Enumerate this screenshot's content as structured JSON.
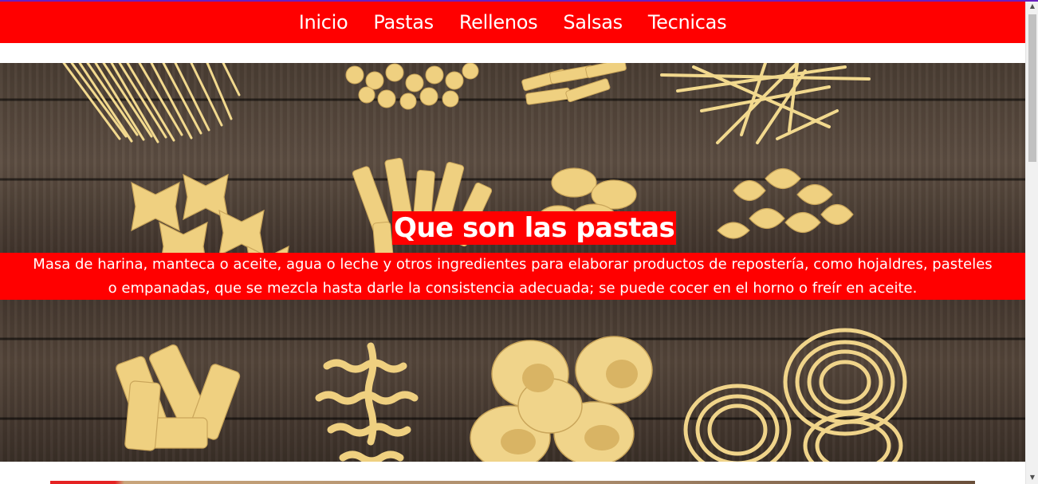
{
  "nav": {
    "items": [
      {
        "label": "Inicio"
      },
      {
        "label": "Pastas"
      },
      {
        "label": "Rellenos"
      },
      {
        "label": "Salsas"
      },
      {
        "label": "Tecnicas"
      }
    ]
  },
  "hero": {
    "title": "Que son las pastas",
    "description": "Masa de harina, manteca o aceite, agua o leche y otros ingredientes para elaborar productos de repostería, como hojaldres, pasteles o empanadas, que se mezcla hasta darle la consistencia adecuada; se puede cocer en el horno o freír en aceite."
  },
  "colors": {
    "accent": "#ff0000",
    "text_on_accent": "#ffffff",
    "wood": "#4a3d33",
    "pasta": "#f0d48a"
  },
  "icons": {
    "scroll_up": "triangle-up",
    "scroll_down": "triangle-down"
  }
}
